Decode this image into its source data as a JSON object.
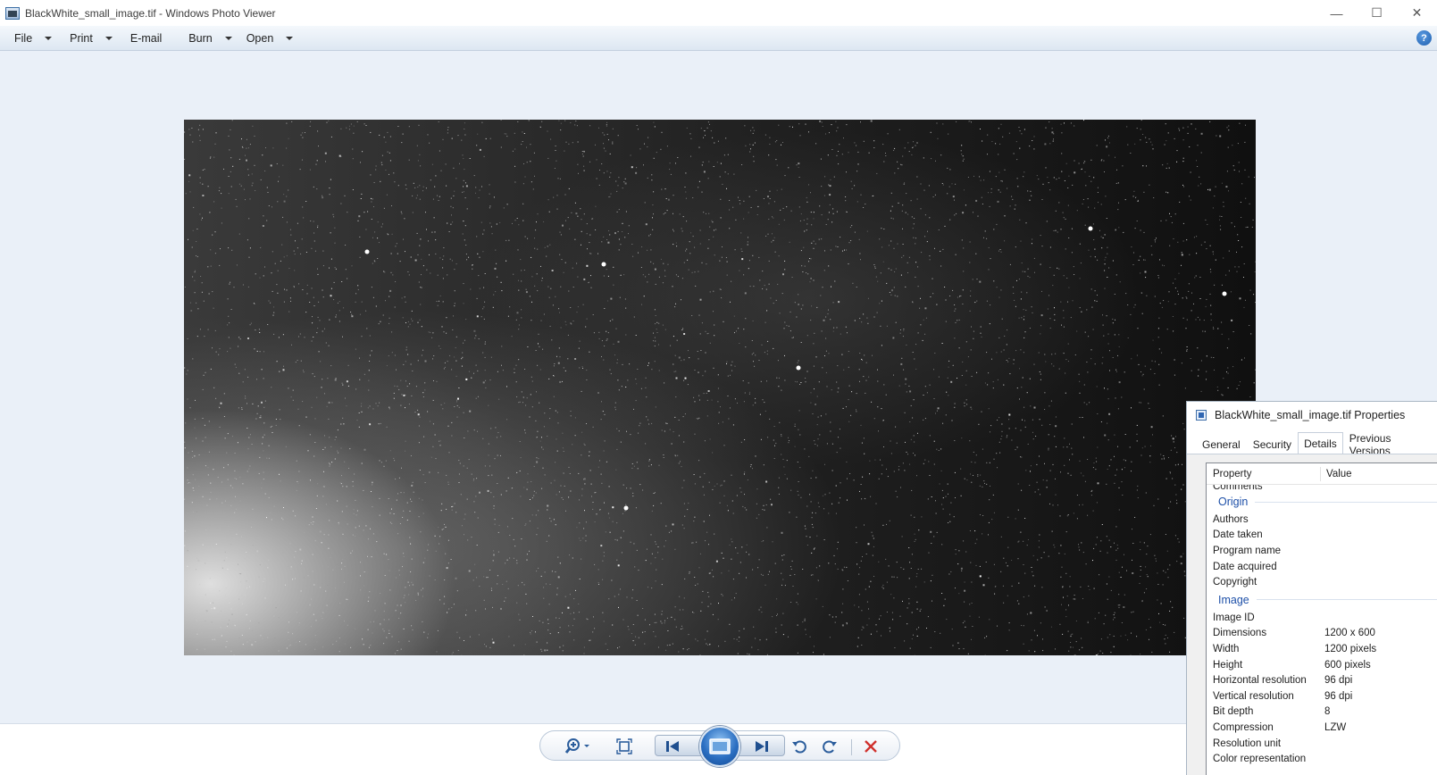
{
  "window": {
    "title": "BlackWhite_small_image.tif - Windows Photo Viewer",
    "minimize_glyph": "—",
    "maximize_glyph": "☐",
    "close_glyph": "✕"
  },
  "menu": {
    "file": "File",
    "print": "Print",
    "email": "E-mail",
    "burn": "Burn",
    "open": "Open",
    "help_glyph": "?"
  },
  "photo": {
    "description_icon": "starfield-image"
  },
  "toolbar": {
    "zoom_icon": "zoom-icon",
    "fit_icon": "actual-size-icon",
    "prev_icon": "previous-icon",
    "slideshow_icon": "slideshow-icon",
    "next_icon": "next-icon",
    "rotate_ccw_icon": "rotate-counterclockwise-icon",
    "rotate_cw_icon": "rotate-clockwise-icon",
    "delete_icon": "delete-icon"
  },
  "properties": {
    "title": "BlackWhite_small_image.tif Properties",
    "tabs": [
      "General",
      "Security",
      "Details",
      "Previous Versions"
    ],
    "active_tab": "Details",
    "header_property": "Property",
    "header_value": "Value",
    "cut_row": "Comments",
    "groups": {
      "origin": "Origin",
      "image": "Image"
    },
    "origin_rows": [
      {
        "k": "Authors",
        "v": ""
      },
      {
        "k": "Date taken",
        "v": ""
      },
      {
        "k": "Program name",
        "v": ""
      },
      {
        "k": "Date acquired",
        "v": ""
      },
      {
        "k": "Copyright",
        "v": ""
      }
    ],
    "image_rows": [
      {
        "k": "Image ID",
        "v": ""
      },
      {
        "k": "Dimensions",
        "v": "1200 x 600"
      },
      {
        "k": "Width",
        "v": "1200 pixels"
      },
      {
        "k": "Height",
        "v": "600 pixels"
      },
      {
        "k": "Horizontal resolution",
        "v": "96 dpi"
      },
      {
        "k": "Vertical resolution",
        "v": "96 dpi"
      },
      {
        "k": "Bit depth",
        "v": "8"
      },
      {
        "k": "Compression",
        "v": "LZW"
      },
      {
        "k": "Resolution unit",
        "v": ""
      },
      {
        "k": "Color representation",
        "v": ""
      }
    ]
  }
}
